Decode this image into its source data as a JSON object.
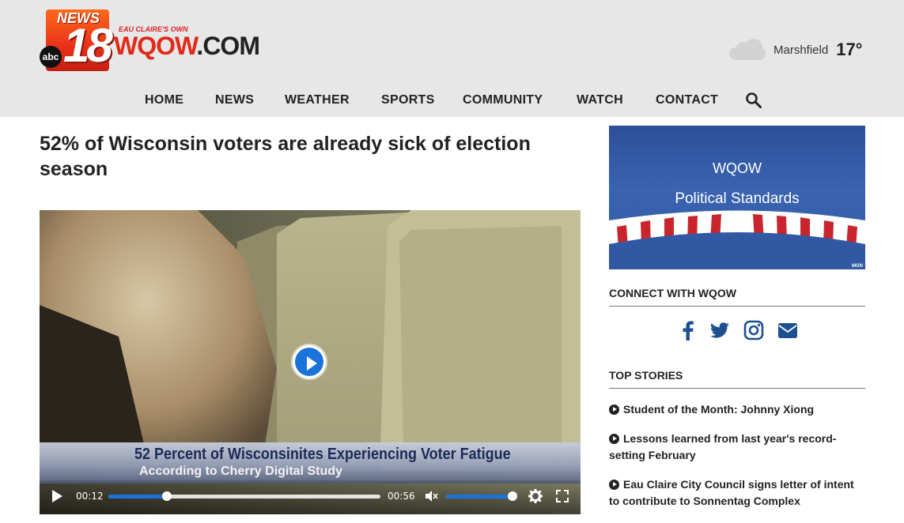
{
  "header": {
    "logo": {
      "news_text": "NEWS",
      "channel_number": "18",
      "network": "abc",
      "tagline": "EAU CLAIRE'S OWN",
      "site_name": "WQOW",
      "site_suffix": ".COM"
    },
    "weather": {
      "icon": "cloud-icon",
      "city": "Marshfield",
      "temperature": "17°"
    },
    "nav": [
      {
        "label": "HOME"
      },
      {
        "label": "NEWS"
      },
      {
        "label": "WEATHER"
      },
      {
        "label": "SPORTS"
      },
      {
        "label": "COMMUNITY"
      },
      {
        "label": "WATCH"
      },
      {
        "label": "CONTACT"
      }
    ],
    "search_icon": "search-icon"
  },
  "article": {
    "title": "52% of Wisconsin voters are already sick of election season",
    "video": {
      "lower_third_line1": "52 Percent of Wisconsinites Experiencing Voter Fatigue",
      "lower_third_line2": "According to Cherry Digital Study",
      "current_time": "00:12",
      "duration": "00:56",
      "progress_fraction": 0.214,
      "volume_fraction": 1.0,
      "accent_color": "#1a73d9"
    }
  },
  "sidebar": {
    "ad": {
      "line1": "WQOW",
      "line2": "Political Standards",
      "credit": "MGN"
    },
    "connect": {
      "heading": "CONNECT WITH WQOW",
      "icons": [
        "facebook-icon",
        "twitter-icon",
        "instagram-icon",
        "email-icon"
      ]
    },
    "top_stories": {
      "heading": "TOP STORIES",
      "items": [
        {
          "title": "Student of the Month: Johnny Xiong"
        },
        {
          "title": "Lessons learned from last year's record-setting February"
        },
        {
          "title": "Eau Claire City Council signs letter of intent to contribute to Sonnentag Complex"
        }
      ]
    }
  },
  "colors": {
    "header_bg": "#e7e7e7",
    "brand_red": "#e02a1a",
    "social_blue": "#1d4f91"
  }
}
